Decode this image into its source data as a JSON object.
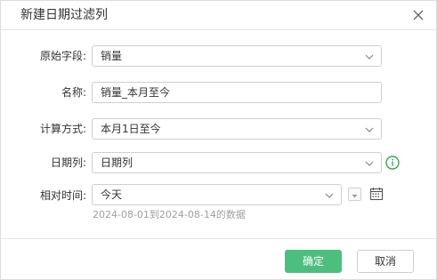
{
  "dialog": {
    "title": "新建日期过滤列"
  },
  "form": {
    "source_field": {
      "label": "原始字段:",
      "value": "销量"
    },
    "name": {
      "label": "名称:",
      "value": "销量_本月至今"
    },
    "calc_method": {
      "label": "计算方式:",
      "value": "本月1日至今"
    },
    "date_column": {
      "label": "日期列:",
      "value": "日期列"
    },
    "relative_time": {
      "label": "相对时间:",
      "value": "今天"
    },
    "range_hint": "2024-08-01到2024-08-14的数据"
  },
  "footer": {
    "ok_label": "确定",
    "cancel_label": "取消"
  },
  "colors": {
    "accent": "#4cbf7e",
    "info": "#2eaa4a"
  }
}
